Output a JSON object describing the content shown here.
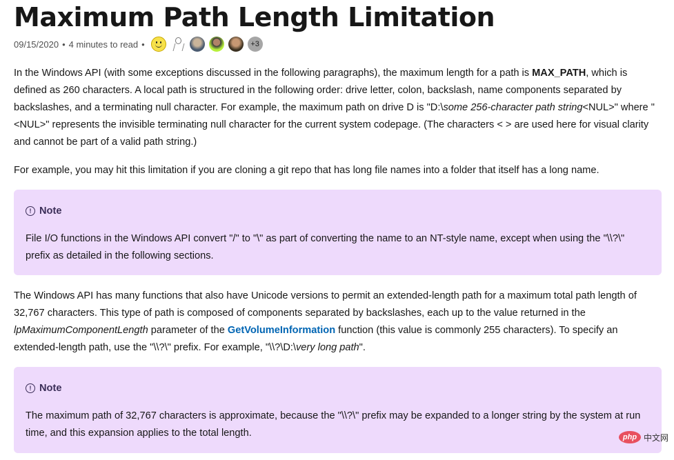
{
  "article": {
    "title": "Maximum Path Length Limitation",
    "date": "09/15/2020",
    "separator": "•",
    "read_time": "4 minutes to read",
    "contributors": [
      {
        "icon": "smiley-avatar"
      },
      {
        "icon": "sketch-avatar"
      },
      {
        "icon": "photo-avatar"
      },
      {
        "icon": "photo-avatar"
      },
      {
        "icon": "photo-avatar"
      }
    ],
    "more_contributors": "+3"
  },
  "paragraphs": {
    "p1": {
      "t1": "In the Windows API (with some exceptions discussed in the following paragraphs), the maximum length for a path is ",
      "bold": "MAX_PATH",
      "t2": ", which is defined as 260 characters. A local path is structured in the following order: drive letter, colon, backslash, name components separated by backslashes, and a terminating null character. For example, the maximum path on drive D is \"D:\\",
      "italic": "some 256-character path string",
      "t3": "<NUL>\" where \"<NUL>\" represents the invisible terminating null character for the current system codepage. (The characters < > are used here for visual clarity and cannot be part of a valid path string.)"
    },
    "p2": "For example, you may hit this limitation if you are cloning a git repo that has long file names into a folder that itself has a long name.",
    "p3": {
      "t1": "The Windows API has many functions that also have Unicode versions to permit an extended-length path for a maximum total path length of 32,767 characters. This type of path is composed of components separated by backslashes, each up to the value returned in the ",
      "italic": "lpMaximumComponentLength",
      "t2": " parameter of the ",
      "link": "GetVolumeInformation",
      "t3": " function (this value is commonly 255 characters). To specify an extended-length path, use the \"\\\\?\\\" prefix. For example, \"\\\\?\\D:\\",
      "italic2": "very long path",
      "t4": "\"."
    }
  },
  "notes": [
    {
      "title": "Note",
      "body": "File I/O functions in the Windows API convert \"/\" to \"\\\" as part of converting the name to an NT-style name, except when using the \"\\\\?\\\" prefix as detailed in the following sections."
    },
    {
      "title": "Note",
      "body": "The maximum path of 32,767 characters is approximate, because the \"\\\\?\\\" prefix may be expanded to a longer string by the system at run time, and this expansion applies to the total length."
    }
  ],
  "note_icon": "!",
  "watermark": {
    "badge": "php",
    "text": "中文网"
  },
  "colors": {
    "note_bg": "#eedafc",
    "link": "#0065b3",
    "note_title": "#3b2e58"
  }
}
